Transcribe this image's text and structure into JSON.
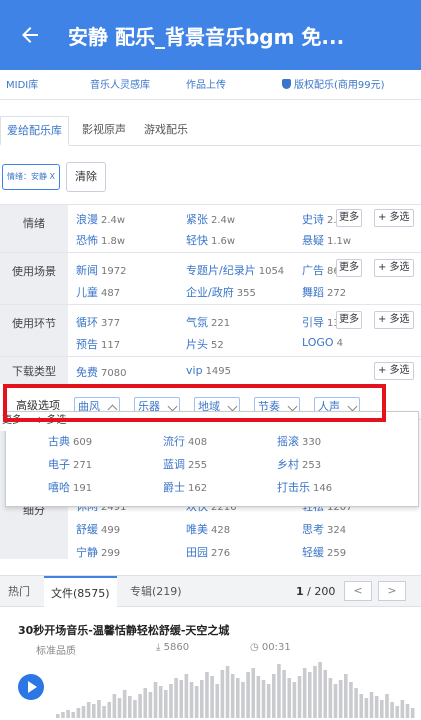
{
  "header": {
    "title": "安静 配乐_背景音乐bgm 免..."
  },
  "topnav": {
    "items": [
      "MIDI库",
      "音乐人灵感库",
      "作品上传"
    ],
    "license": "版权配乐(商用99元)"
  },
  "tabs": [
    "爱给配乐库",
    "影视原声",
    "游戏配乐"
  ],
  "active_filter": {
    "chip": "情绪：安静 X",
    "clear": "清除"
  },
  "filters": [
    {
      "label": "情绪",
      "options": [
        {
          "name": "浪漫",
          "count": "2.4w"
        },
        {
          "name": "紧张",
          "count": "2.4w"
        },
        {
          "name": "史诗",
          "count": "2.4w"
        },
        {
          "name": "恐怖",
          "count": "1.8w"
        },
        {
          "name": "轻快",
          "count": "1.6w"
        },
        {
          "name": "悬疑",
          "count": "1.1w"
        }
      ],
      "more": "更多",
      "multi": "+ 多选"
    },
    {
      "label": "使用场景",
      "options": [
        {
          "name": "新闻",
          "count": "1972"
        },
        {
          "name": "专题片/纪录片",
          "count": "1054"
        },
        {
          "name": "广告",
          "count": "86"
        },
        {
          "name": "儿童",
          "count": "487"
        },
        {
          "name": "企业/政府",
          "count": "355"
        },
        {
          "name": "舞蹈",
          "count": "272"
        }
      ],
      "more": "更多",
      "multi": "+ 多选"
    },
    {
      "label": "使用环节",
      "options": [
        {
          "name": "循环",
          "count": "377"
        },
        {
          "name": "气氛",
          "count": "221"
        },
        {
          "name": "引导",
          "count": "135"
        },
        {
          "name": "预告",
          "count": "117"
        },
        {
          "name": "片头",
          "count": "52"
        },
        {
          "name": "LOGO",
          "count": "4"
        }
      ],
      "more": "更多",
      "multi": "+ 多选"
    },
    {
      "label": "下载类型",
      "options": [
        {
          "name": "免费",
          "count": "7080"
        },
        {
          "name": "vip",
          "count": "1495"
        }
      ],
      "multi": "+ 多选"
    }
  ],
  "advanced": {
    "label": "高级选项",
    "buttons": [
      "曲风",
      "乐器",
      "地域",
      "节奏",
      "人声"
    ]
  },
  "dropdown": {
    "more": "更多",
    "multi": "+ 多选",
    "options": [
      {
        "name": "古典",
        "count": "609"
      },
      {
        "name": "流行",
        "count": "408"
      },
      {
        "name": "摇滚",
        "count": "330"
      },
      {
        "name": "电子",
        "count": "271"
      },
      {
        "name": "蓝调",
        "count": "255"
      },
      {
        "name": "乡村",
        "count": "253"
      },
      {
        "name": "嘻哈",
        "count": "191"
      },
      {
        "name": "爵士",
        "count": "162"
      },
      {
        "name": "打击乐",
        "count": "146"
      }
    ]
  },
  "hidden_row": {
    "label": "细分",
    "options": [
      {
        "name": "休闲",
        "count": "2491"
      },
      {
        "name": "欢快",
        "count": "2216"
      },
      {
        "name": "轻松",
        "count": "1207"
      },
      {
        "name": "舒缓",
        "count": "499"
      },
      {
        "name": "唯美",
        "count": "428"
      },
      {
        "name": "思考",
        "count": "324"
      },
      {
        "name": "宁静",
        "count": "299"
      },
      {
        "name": "田园",
        "count": "276"
      },
      {
        "name": "轻缓",
        "count": "259"
      }
    ]
  },
  "result_tabs": [
    "热门",
    "文件(8575)",
    "专辑(219)"
  ],
  "pager": {
    "current": "1",
    "total": "/ 200",
    "prev": "<",
    "next": ">"
  },
  "track": {
    "title": "30秒开场音乐-温馨恬静轻松舒缓-天空之城",
    "quality": "标准品质",
    "downloads": "5860",
    "duration": "00:31"
  },
  "colors": {
    "accent": "#3f83e6",
    "highlight": "#e4121c"
  },
  "waveform": [
    2,
    3,
    4,
    3,
    5,
    6,
    8,
    7,
    9,
    6,
    8,
    12,
    10,
    14,
    11,
    9,
    12,
    15,
    13,
    18,
    16,
    14,
    17,
    20,
    19,
    22,
    18,
    16,
    19,
    23,
    21,
    17,
    24,
    26,
    22,
    20,
    18,
    23,
    25,
    21,
    19,
    17,
    22,
    27,
    24,
    20,
    18,
    21,
    25,
    23,
    26,
    28,
    24,
    20,
    17,
    19,
    22,
    18,
    15,
    12,
    10,
    13,
    11,
    9,
    12,
    8,
    6,
    9,
    7,
    5
  ]
}
